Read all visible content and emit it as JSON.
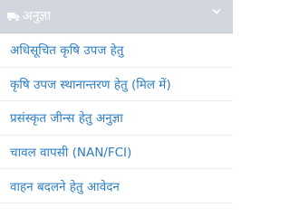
{
  "section": {
    "icon": "truck-icon",
    "title": "अनुज्ञा",
    "toggle_icon": "chevron-down-icon"
  },
  "items": [
    {
      "label": "अधिसूचित कृषि उपज हेतु"
    },
    {
      "label": "कृषि उपज स्थानान्तरण हेतु (मिल में)"
    },
    {
      "label": "प्रसंस्कृत जीन्स हेतु अनुज्ञा"
    },
    {
      "label": "चावल वापसी (NAN/FCI)"
    },
    {
      "label": "वाहन बदलने हेतु आवेदन"
    }
  ],
  "colors": {
    "header_bg": "#d2d6de",
    "header_text": "#ffffff",
    "link": "#2e7ec4",
    "divider": "#ececec"
  }
}
